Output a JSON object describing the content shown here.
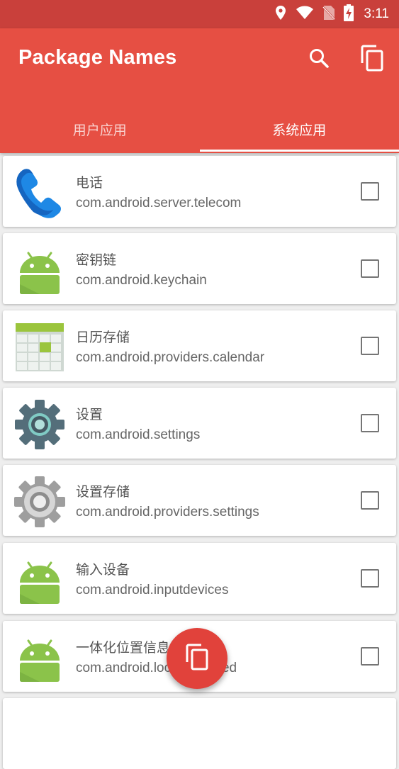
{
  "status_bar": {
    "time": "3:11"
  },
  "app_bar": {
    "title": "Package Names"
  },
  "tabs": [
    {
      "label": "用户应用",
      "active": false
    },
    {
      "label": "系统应用",
      "active": true
    }
  ],
  "apps": [
    {
      "name": "电话",
      "package": "com.android.server.telecom",
      "icon": "phone-icon",
      "checked": false
    },
    {
      "name": "密钥链",
      "package": "com.android.keychain",
      "icon": "android-robot-icon",
      "checked": false
    },
    {
      "name": "日历存储",
      "package": "com.android.providers.calendar",
      "icon": "calendar-icon",
      "checked": false
    },
    {
      "name": "设置",
      "package": "com.android.settings",
      "icon": "settings-gear-icon",
      "checked": false
    },
    {
      "name": "设置存储",
      "package": "com.android.providers.settings",
      "icon": "settings-storage-gear-icon",
      "checked": false
    },
    {
      "name": "输入设备",
      "package": "com.android.inputdevices",
      "icon": "android-robot-icon",
      "checked": false
    },
    {
      "name": "一体化位置信息",
      "package": "com.android.location.fused",
      "icon": "android-robot-icon",
      "checked": false
    }
  ],
  "colors": {
    "primary": "#e64f43",
    "primary_dark": "#c9403b",
    "fab": "#e1423b"
  }
}
